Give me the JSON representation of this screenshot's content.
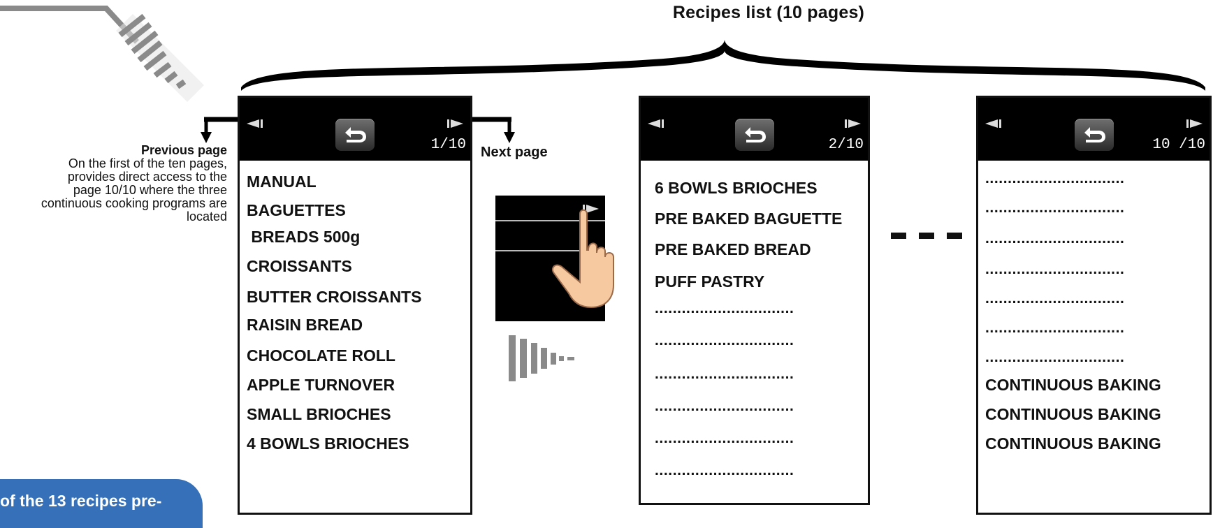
{
  "title": "Recipes list (10 pages)",
  "prev_label": {
    "heading": "Previous page",
    "lines": [
      "On the first of the ten pages,",
      "provides direct access to the",
      "page 10/10 where the three",
      "continuous cooking programs are",
      "located"
    ]
  },
  "next_label": "Next page",
  "panels": [
    {
      "page": "1/10",
      "items": [
        "MANUAL",
        "BAGUETTES",
        " BREADS 500g",
        "CROISSANTS",
        "BUTTER CROISSANTS",
        "RAISIN BREAD",
        "CHOCOLATE ROLL",
        "APPLE TURNOVER",
        "SMALL BRIOCHES",
        "4 BOWLS BRIOCHES"
      ]
    },
    {
      "page": "2/10",
      "items": [
        "6 BOWLS BRIOCHES",
        "PRE BAKED BAGUETTE",
        "PRE BAKED BREAD",
        "PUFF PASTRY",
        "...............................",
        "...............................",
        "...............................",
        "...............................",
        "...............................",
        "..............................."
      ]
    },
    {
      "page": "10 /10",
      "items": [
        "...............................",
        "...............................",
        "...............................",
        "...............................",
        "...............................",
        "...............................",
        "...............................",
        "CONTINUOUS BAKING",
        "CONTINUOUS BAKING",
        "CONTINUOUS BAKING"
      ]
    }
  ],
  "bubble_text": "of the 13 recipes pre-",
  "icons": {
    "prev": "triangle-left-icon",
    "next": "triangle-right-icon",
    "back": "return-arrow-icon",
    "hand": "pointing-hand-icon",
    "wave": "signal-bars-icon",
    "logo": "knife-logo-icon"
  },
  "colors": {
    "header": "#000000",
    "bubble": "#3570b8",
    "hand": "#f7c9a0"
  }
}
